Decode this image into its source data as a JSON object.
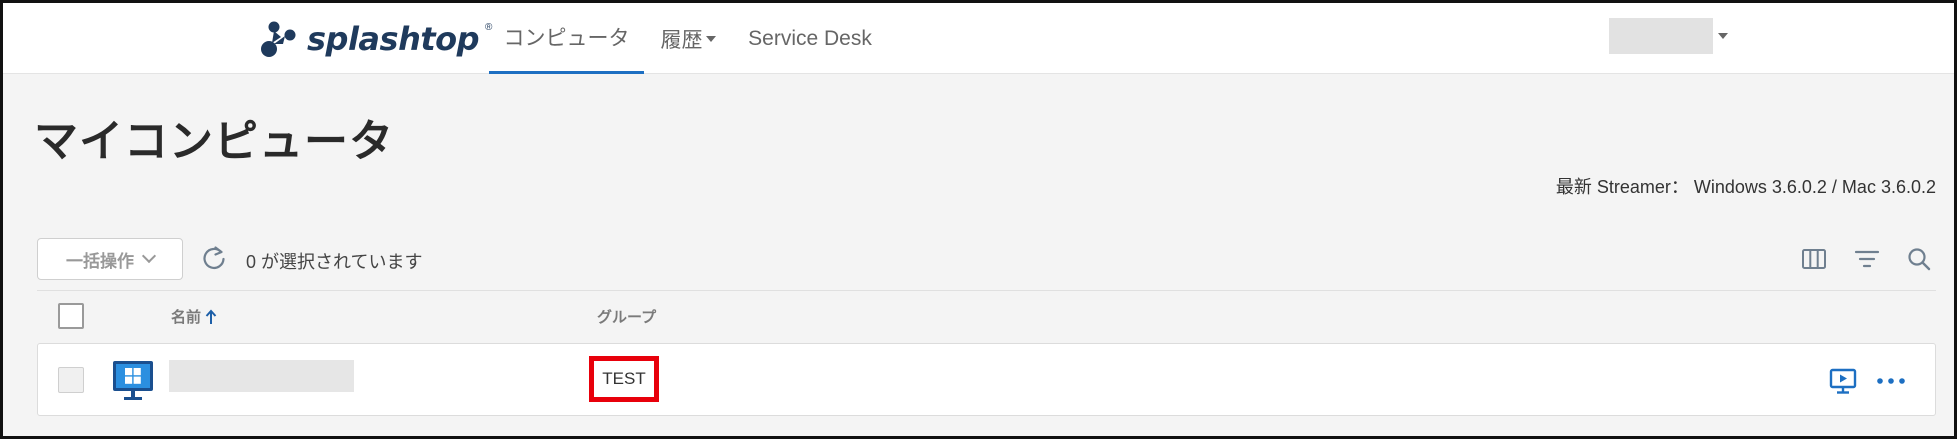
{
  "brand": {
    "name": "splashtop",
    "mark": "®",
    "color": "#1f3a5c"
  },
  "nav": {
    "tabs": [
      {
        "label": "コンピュータ",
        "active": true
      },
      {
        "label": "履歴",
        "active": false
      },
      {
        "label": "Service Desk",
        "active": false
      }
    ],
    "accent_color": "#1d6fc2"
  },
  "page": {
    "title": "マイコンピュータ",
    "streamer_info": "最新 Streamer： Windows 3.6.0.2 / Mac 3.6.0.2"
  },
  "toolbar": {
    "bulk_action_label": "一括操作",
    "selection_status": "0 が選択されています",
    "icons": [
      "refresh-icon",
      "columns-icon",
      "filter-icon",
      "search-icon"
    ]
  },
  "table": {
    "columns": [
      {
        "label": "名前",
        "sort": "asc"
      },
      {
        "label": "グループ"
      }
    ],
    "rows": [
      {
        "os": "windows",
        "group": "TEST"
      }
    ],
    "highlight_color": "#e8000b"
  }
}
